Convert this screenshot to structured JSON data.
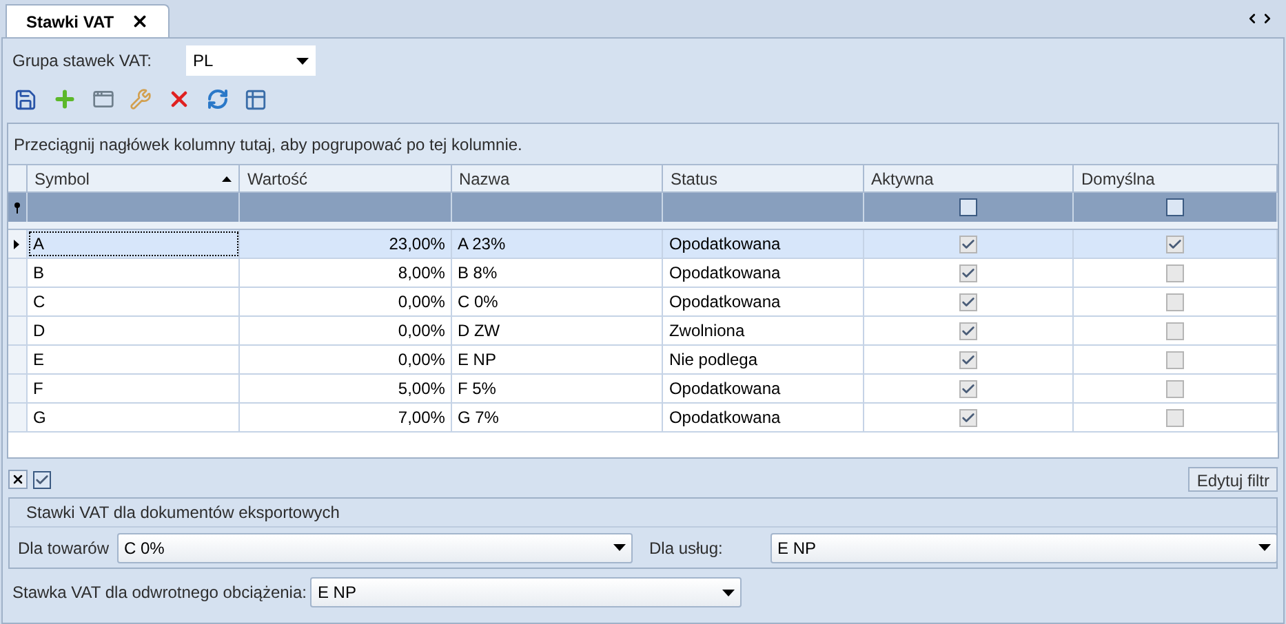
{
  "tabs": [
    {
      "label": "Stawki VAT",
      "selected": true
    }
  ],
  "group_field": {
    "label": "Grupa stawek VAT:",
    "value": "PL"
  },
  "group_hint": "Przeciągnij nagłówek kolumny tutaj, aby pogrupować po tej kolumnie.",
  "table": {
    "columns": [
      {
        "label": "Symbol",
        "sorted": true,
        "kind": "text"
      },
      {
        "label": "Wartość",
        "sorted": false,
        "kind": "number"
      },
      {
        "label": "Nazwa",
        "sorted": false,
        "kind": "text"
      },
      {
        "label": "Status",
        "sorted": false,
        "kind": "text"
      },
      {
        "label": "Aktywna",
        "sorted": false,
        "kind": "check",
        "filter_checked": false
      },
      {
        "label": "Domyślna",
        "sorted": false,
        "kind": "check",
        "filter_checked": false
      }
    ],
    "rows": [
      {
        "selected": true,
        "cells": [
          "A",
          "23,00%",
          "A 23%",
          "Opodatkowana",
          true,
          true
        ]
      },
      {
        "selected": false,
        "cells": [
          "B",
          "8,00%",
          "B 8%",
          "Opodatkowana",
          true,
          false
        ]
      },
      {
        "selected": false,
        "cells": [
          "C",
          "0,00%",
          "C 0%",
          "Opodatkowana",
          true,
          false
        ]
      },
      {
        "selected": false,
        "cells": [
          "D",
          "0,00%",
          "D ZW",
          "Zwolniona",
          true,
          false
        ]
      },
      {
        "selected": false,
        "cells": [
          "E",
          "0,00%",
          "E NP",
          "Nie podlega",
          true,
          false
        ]
      },
      {
        "selected": false,
        "cells": [
          "F",
          "5,00%",
          "F 5%",
          "Opodatkowana",
          true,
          false
        ]
      },
      {
        "selected": false,
        "cells": [
          "G",
          "7,00%",
          "G 7%",
          "Opodatkowana",
          true,
          false
        ]
      }
    ]
  },
  "filter_bar": {
    "enabled": true,
    "button": "Edytuj filtr"
  },
  "export_group": {
    "title": "Stawki VAT dla dokumentów eksportowych",
    "fields": [
      {
        "label": "Dla towarów",
        "value": "C 0%"
      },
      {
        "label": "Dla usług:",
        "value": "E NP"
      }
    ]
  },
  "reverse_charge": {
    "label": "Stawka VAT dla odwrotnego obciążenia:",
    "value": "E NP"
  }
}
